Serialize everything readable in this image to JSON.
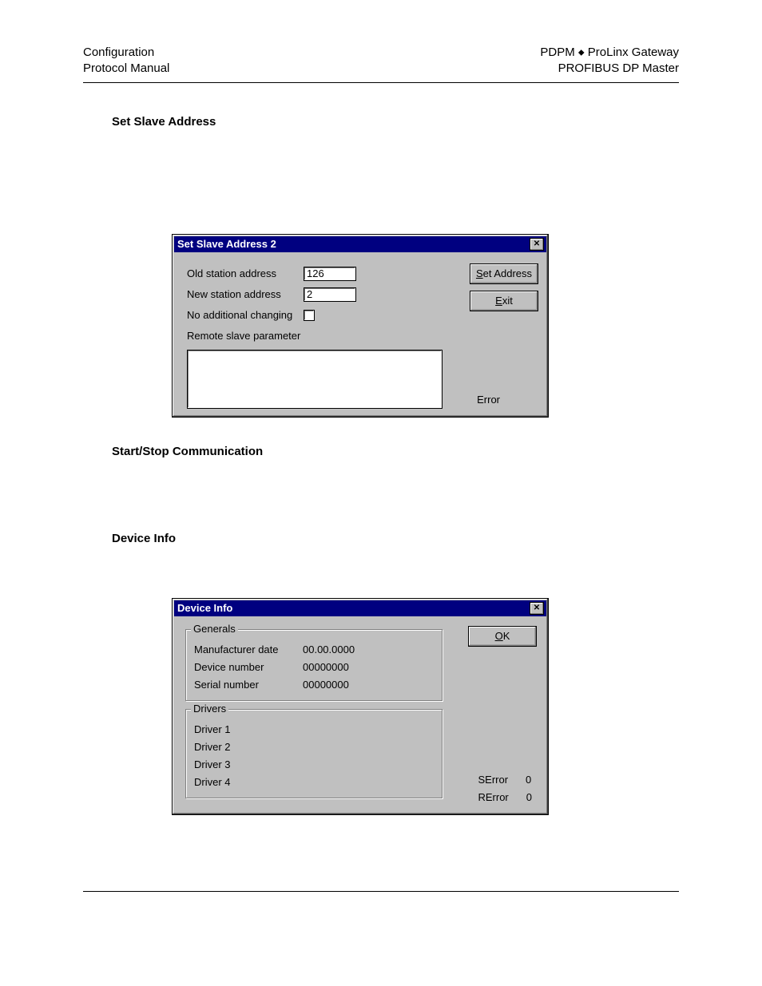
{
  "header": {
    "left_line1": "Configuration",
    "left_line2": "Protocol Manual",
    "right_line1_a": "PDPM ",
    "right_line1_b": " ProLinx Gateway",
    "right_line2": "PROFIBUS DP Master"
  },
  "sections": {
    "set_slave_address": "Set Slave Address",
    "start_stop": "Start/Stop Communication",
    "device_info": "Device Info"
  },
  "dialog1": {
    "title": "Set Slave Address 2",
    "old_station_label": "Old station address",
    "old_station_value": "126",
    "new_station_label": "New station address",
    "new_station_value": "2",
    "no_additional_label": "No additional changing",
    "remote_label": "Remote slave parameter",
    "btn_set_u": "S",
    "btn_set_rest": "et Address",
    "btn_exit_u": "E",
    "btn_exit_rest": "xit",
    "error_label": "Error"
  },
  "dialog2": {
    "title": "Device Info",
    "group_generals": "Generals",
    "manufacturer_label": "Manufacturer date",
    "manufacturer_value": "00.00.0000",
    "device_number_label": "Device number",
    "device_number_value": "00000000",
    "serial_number_label": "Serial number",
    "serial_number_value": "00000000",
    "group_drivers": "Drivers",
    "driver1": "Driver 1",
    "driver2": "Driver 2",
    "driver3": "Driver 3",
    "driver4": "Driver 4",
    "btn_ok_u": "O",
    "btn_ok_rest": "K",
    "serror_label": "SError",
    "serror_value": "0",
    "rerror_label": "RError",
    "rerror_value": "0"
  }
}
